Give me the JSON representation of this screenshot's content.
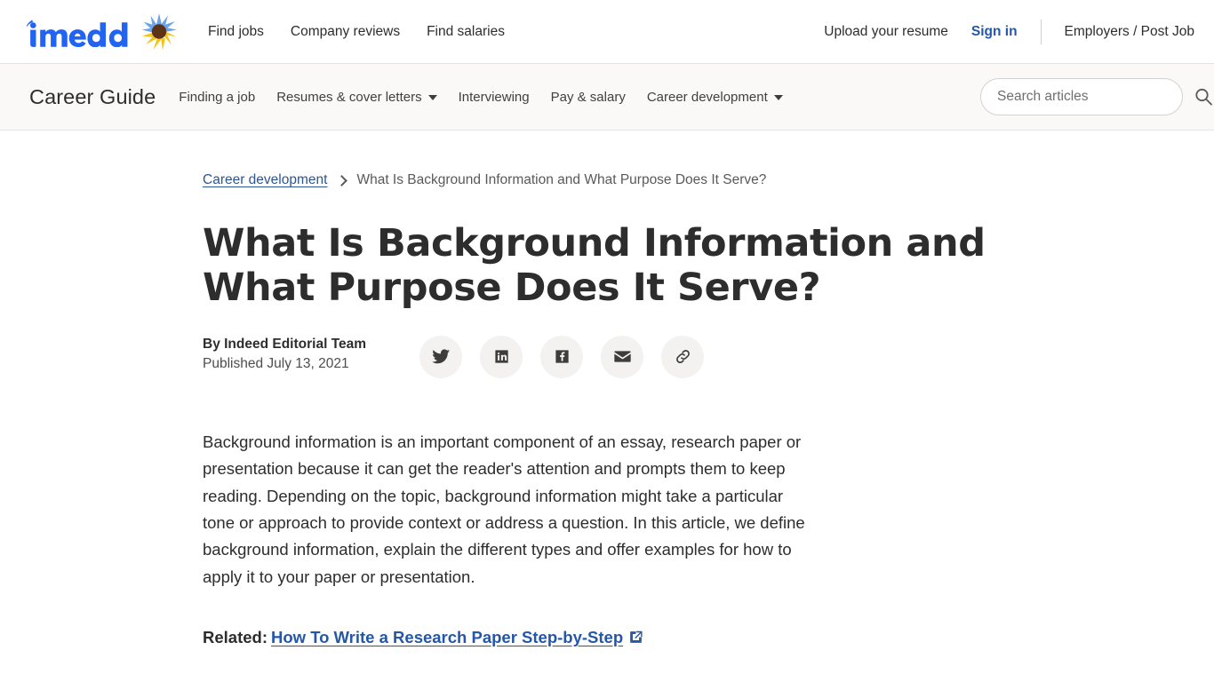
{
  "header": {
    "logo_text": "indeed",
    "logo_icon": "indeed-logo",
    "sunflower_icon": "sunflower-icon",
    "nav": [
      {
        "label": "Find jobs",
        "name": "nav-find-jobs"
      },
      {
        "label": "Company reviews",
        "name": "nav-company-reviews"
      },
      {
        "label": "Find salaries",
        "name": "nav-find-salaries"
      }
    ],
    "upload_resume": "Upload your resume",
    "sign_in": "Sign in",
    "employers": "Employers / Post Job",
    "signin_color": "#2557a7"
  },
  "guide_bar": {
    "title": "Career Guide",
    "nav": [
      {
        "label": "Finding a job",
        "has_dropdown": false,
        "name": "guide-nav-finding-a-job"
      },
      {
        "label": "Resumes & cover letters",
        "has_dropdown": true,
        "name": "guide-nav-resumes-cover-letters"
      },
      {
        "label": "Interviewing",
        "has_dropdown": false,
        "name": "guide-nav-interviewing"
      },
      {
        "label": "Pay & salary",
        "has_dropdown": false,
        "name": "guide-nav-pay-salary"
      },
      {
        "label": "Career development",
        "has_dropdown": true,
        "name": "guide-nav-career-development"
      }
    ],
    "search_placeholder": "Search articles",
    "search_value": "",
    "search_icon": "search-icon",
    "background_color": "#faf9f8"
  },
  "breadcrumb": {
    "parent": "Career development",
    "current": "What Is Background Information and What Purpose Does It Serve?",
    "separator_icon": "chevron-right-icon"
  },
  "article": {
    "title": "What Is Background Information and What Purpose Does It Serve?",
    "author": "By Indeed Editorial Team",
    "published": "Published July 13, 2021",
    "share_buttons": [
      {
        "name": "share-twitter-button",
        "icon": "twitter-icon"
      },
      {
        "name": "share-linkedin-button",
        "icon": "linkedin-icon"
      },
      {
        "name": "share-facebook-button",
        "icon": "facebook-icon"
      },
      {
        "name": "share-email-button",
        "icon": "email-icon"
      },
      {
        "name": "share-copy-link-button",
        "icon": "link-icon"
      }
    ],
    "intro_paragraph": "Background information is an important component of an essay, research paper or presentation because it can get the reader's attention and prompts them to keep reading. Depending on the topic, background information might take a particular tone or approach to provide context or address a question. In this article, we define background information, explain the different types and offer examples for how to apply it to your paper or presentation.",
    "related_label": "Related:",
    "related_link_text": "How To Write a Research Paper Step-by-Step",
    "related_link_icon": "external-link-icon",
    "link_color": "#2557a7"
  }
}
